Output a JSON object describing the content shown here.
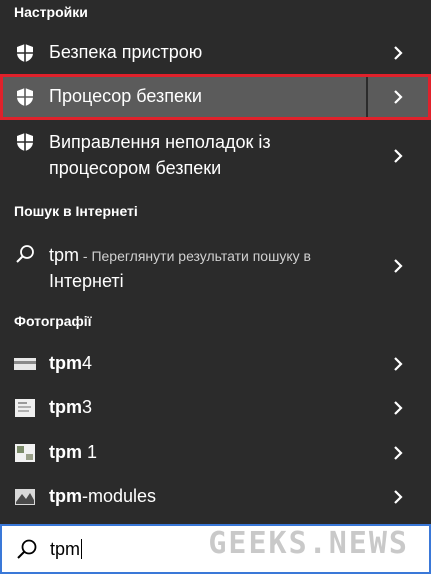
{
  "sections": {
    "settings_header": "Настройки",
    "web_header": "Пошук в Інтернеті",
    "photos_header": "Фотографії"
  },
  "settings_items": [
    {
      "label": "Безпека пристрою",
      "icon": "shield-icon"
    },
    {
      "label": "Процесор безпеки",
      "icon": "shield-icon"
    },
    {
      "label_line1": "Виправлення неполадок із",
      "label_line2": "процесором безпеки",
      "icon": "shield-icon"
    }
  ],
  "web_result": {
    "term": "tpm",
    "desc_line1": " - Переглянути результати пошуку в",
    "desc_line2": "Інтернеті",
    "icon": "search-icon"
  },
  "photos": [
    {
      "bold": "tpm",
      "rest": "4",
      "icon": "image-thumbnail-icon"
    },
    {
      "bold": "tpm",
      "rest": "3",
      "icon": "image-thumbnail-icon"
    },
    {
      "bold": "tpm",
      "rest": " 1",
      "icon": "image-thumbnail-icon"
    },
    {
      "bold": "tpm",
      "rest": "-modules",
      "icon": "image-thumbnail-icon"
    }
  ],
  "search": {
    "value": "tpm",
    "icon": "search-icon"
  },
  "watermark": "GEEKS.NEWS",
  "colors": {
    "panel_bg": "#2b2b2b",
    "selected_bg": "#5b5b5b",
    "highlight_border": "#e0212b",
    "search_border": "#3a78d8"
  }
}
